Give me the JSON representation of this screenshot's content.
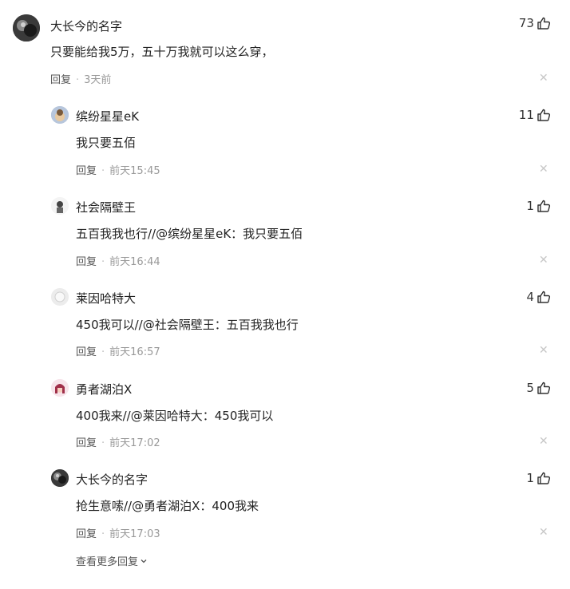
{
  "main_comment": {
    "user": "大长今的名字",
    "text": "只要能给我5万，五十万我就可以这么穿，",
    "likes": "73",
    "reply_label": "回复",
    "time": "3天前"
  },
  "replies": [
    {
      "user": "缤纷星星eK",
      "text": "我只要五佰",
      "likes": "11",
      "reply_label": "回复",
      "time": "前天15:45"
    },
    {
      "user": "社会隔壁王",
      "text": "五百我我也行//@缤纷星星eK：我只要五佰",
      "likes": "1",
      "reply_label": "回复",
      "time": "前天16:44"
    },
    {
      "user": "莱因哈特大",
      "text": "450我可以//@社会隔壁王：五百我我也行",
      "likes": "4",
      "reply_label": "回复",
      "time": "前天16:57"
    },
    {
      "user": "勇者湖泊X",
      "text": "400我来//@莱因哈特大：450我可以",
      "likes": "5",
      "reply_label": "回复",
      "time": "前天17:02"
    },
    {
      "user": "大长今的名字",
      "text": "抢生意嗦//@勇者湖泊X：400我来",
      "likes": "1",
      "reply_label": "回复",
      "time": "前天17:03"
    }
  ],
  "more_replies": "查看更多回复",
  "icons": {
    "like": "thumbs-up-icon",
    "close": "close-icon",
    "more": "chevron-down-icon"
  },
  "colors": {
    "text": "#222222",
    "meta": "#555555",
    "time": "#999999",
    "close": "#c8c8c8"
  }
}
